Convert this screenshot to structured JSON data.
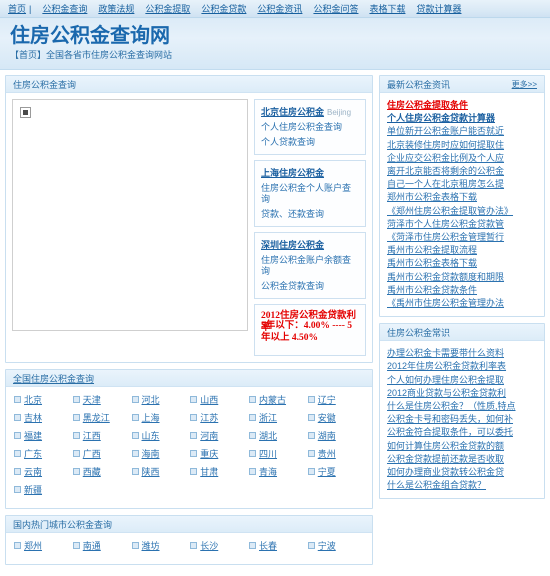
{
  "topnav": {
    "items": [
      "首页",
      "公积金查询",
      "政策法规",
      "公积金提取",
      "公积金贷款",
      "公积金资讯",
      "公积金问答",
      "表格下载",
      "贷款计算器"
    ],
    "separator": "|"
  },
  "header": {
    "title": "住房公积金查询网",
    "subtitle": "【首页】全国各省市住房公积金查询网站"
  },
  "query_panel": {
    "title": "住房公积金查询",
    "map_alt": "broken-image",
    "cities": [
      {
        "name": "北京住房公积金",
        "en": "Beijing",
        "links": [
          "个人住房公积金查询",
          "个人贷款查询"
        ]
      },
      {
        "name": "上海住房公积金",
        "en": "",
        "links": [
          "住房公积金个人账户查询",
          "贷款、还款查询"
        ]
      },
      {
        "name": "深圳住房公积金",
        "en": "",
        "links": [
          "住房公积金账户余额查询",
          "公积金贷款查询"
        ]
      }
    ],
    "rate_box": {
      "title": "2012住房公积金贷款利率",
      "body": "5年以下：4.00% ---- 5年以上 4.50%"
    }
  },
  "national_panel": {
    "title": "全国住房公积金查询",
    "provinces": [
      "北京",
      "天津",
      "河北",
      "山西",
      "内蒙古",
      "辽宁",
      "吉林",
      "黑龙江",
      "上海",
      "江苏",
      "浙江",
      "安徽",
      "福建",
      "江西",
      "山东",
      "河南",
      "湖北",
      "湖南",
      "广东",
      "广西",
      "海南",
      "重庆",
      "四川",
      "贵州",
      "云南",
      "西藏",
      "陕西",
      "甘肃",
      "青海",
      "宁夏",
      "新疆"
    ]
  },
  "hotcity_panel": {
    "title": "国内热门城市公积金查询",
    "cities": [
      "郑州",
      "南通",
      "潍坊",
      "长沙",
      "长春",
      "宁波"
    ]
  },
  "news_panel": {
    "title": "最新公积金资讯",
    "more": "更多>>",
    "items": [
      {
        "text": "住房公积金提取条件",
        "style": "hot"
      },
      {
        "text": "个人住房公积金贷款计算器",
        "style": "strong"
      },
      {
        "text": "单位新开公积金账户能否就近",
        "style": "normal"
      },
      {
        "text": "北京装修住房时应如何提取住",
        "style": "normal"
      },
      {
        "text": "企业应交公积金比例及个人应",
        "style": "normal"
      },
      {
        "text": "离开北京能否将剩余的公积金",
        "style": "normal"
      },
      {
        "text": "自己一个人在北京租房怎么提",
        "style": "normal"
      },
      {
        "text": "郑州市公积金表格下载",
        "style": "normal"
      },
      {
        "text": "《郑州住房公积金提取管办法》",
        "style": "normal"
      },
      {
        "text": "菏泽市个人住房公积金贷款管",
        "style": "normal"
      },
      {
        "text": "《菏泽市住房公积金管理暂行",
        "style": "normal"
      },
      {
        "text": "禹州市公积金提取流程",
        "style": "normal"
      },
      {
        "text": "禹州市公积金表格下载",
        "style": "normal"
      },
      {
        "text": "禹州市公积金贷款额度和期限",
        "style": "normal"
      },
      {
        "text": "禹州市公积金贷款条件",
        "style": "normal"
      },
      {
        "text": "《禹州市住房公积金管理办法",
        "style": "normal"
      }
    ]
  },
  "knowledge_panel": {
    "title": "住房公积金常识",
    "items": [
      {
        "text": "办理公积金卡需要带什么资料"
      },
      {
        "text": "2012年住房公积金贷款利率表"
      },
      {
        "text": "个人如何办理住房公积金提取"
      },
      {
        "text": "2012商业贷款与公积金贷款利"
      },
      {
        "text": "什么是住房公积金？（性质,特点"
      },
      {
        "text": "公积金卡号和密码丢失，如何补"
      },
      {
        "text": "公积金符合提取条件，可以委托"
      },
      {
        "text": "如何计算住房公积金贷款的额"
      },
      {
        "text": "公积金贷款提前还款是否收取"
      },
      {
        "text": "如何办理商业贷款转公积金贷"
      },
      {
        "text": "什么是公积金组合贷款？"
      }
    ]
  },
  "colors": {
    "accent": "#1a68ad",
    "link": "#2b72b0",
    "hot": "#e40000",
    "panel_border": "#c9dff0"
  }
}
